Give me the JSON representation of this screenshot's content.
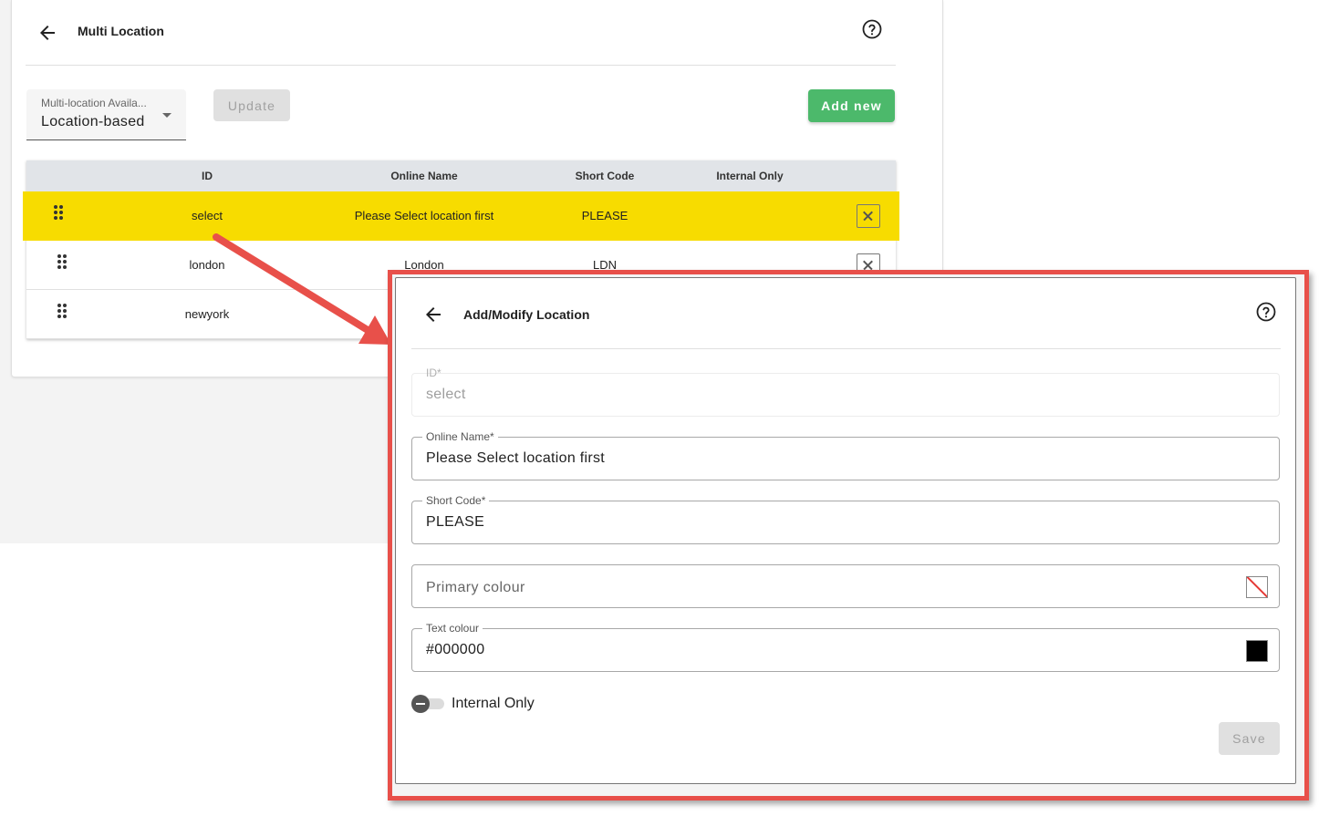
{
  "header": {
    "title": "Multi Location"
  },
  "toolbar": {
    "select_label": "Multi-location Availa...",
    "select_value": "Location-based",
    "update_label": "Update",
    "add_label": "Add new"
  },
  "table": {
    "columns": [
      "ID",
      "Online Name",
      "Short Code",
      "Internal Only"
    ],
    "rows": [
      {
        "id": "select",
        "online_name": "Please Select location first",
        "short_code": "PLEASE"
      },
      {
        "id": "london",
        "online_name": "London",
        "short_code": "LDN"
      },
      {
        "id": "newyork",
        "online_name": "",
        "short_code": ""
      }
    ]
  },
  "modal": {
    "title": "Add/Modify Location",
    "fields": {
      "id": {
        "label": "ID*",
        "value": "select"
      },
      "online_name": {
        "label": "Online Name*",
        "value": "Please Select location first"
      },
      "short_code": {
        "label": "Short Code*",
        "value": "PLEASE"
      },
      "primary_colour": {
        "placeholder": "Primary colour"
      },
      "text_colour": {
        "label": "Text colour",
        "value": "#000000"
      }
    },
    "internal_only_label": "Internal Only",
    "save_label": "Save"
  },
  "colors": {
    "highlight": "#f7dc00",
    "add_button": "#4cb96b",
    "annotation": "#e8504a"
  }
}
